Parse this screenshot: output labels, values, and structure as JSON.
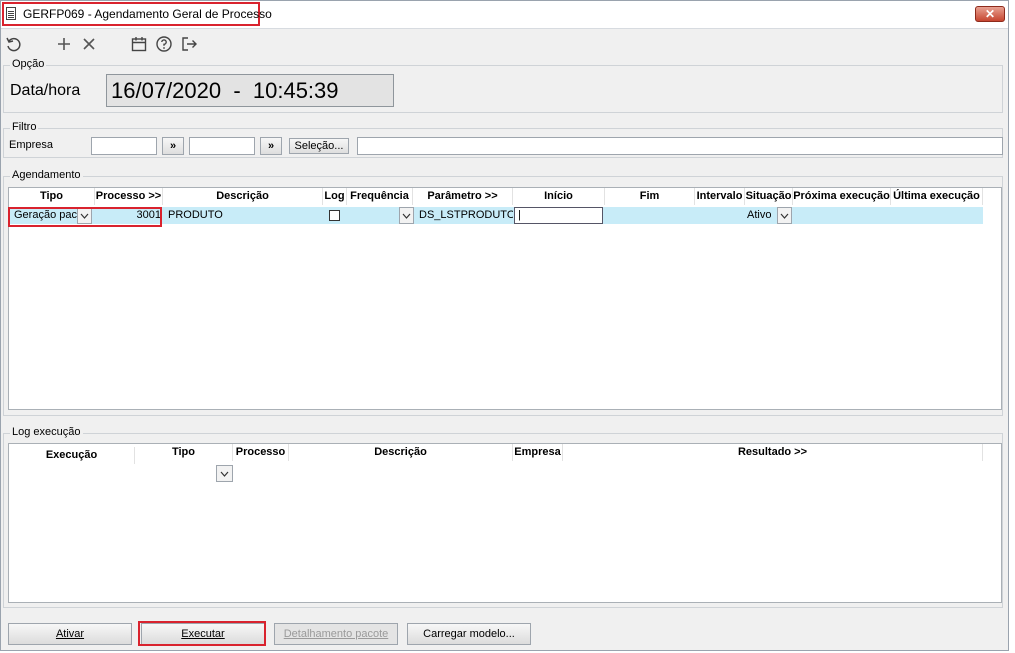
{
  "window": {
    "title": "GERFP069 - Agendamento Geral de Processo",
    "close_glyph": "✕"
  },
  "toolbar": {
    "icons": [
      "undo-icon",
      "plus-icon",
      "close-icon",
      "calendar-icon",
      "help-icon",
      "exit-icon"
    ]
  },
  "opcao": {
    "legend": "Opção",
    "label": "Data/hora",
    "value": "16/07/2020  -  10:45:39"
  },
  "filtro": {
    "legend": "Filtro",
    "empresa_label": "Empresa",
    "from_value": "",
    "to_value": "",
    "arrow1": "»",
    "arrow2": "»",
    "selecao_label": "Seleção...",
    "wide_value": ""
  },
  "agendamento": {
    "legend": "Agendamento",
    "columns": [
      "Tipo",
      "Processo >>",
      "Descrição",
      "Log",
      "Frequência",
      "Parâmetro >>",
      "Início",
      "Fim",
      "Intervalo",
      "Situação",
      "Próxima execução",
      "Última execução"
    ],
    "row": {
      "tipo": "Geração pac",
      "processo": "3001",
      "descricao": "PRODUTO",
      "log_checked": false,
      "frequencia": "",
      "parametro": "DS_LSTPRODUTO=",
      "inicio": "|",
      "fim": "",
      "intervalo": "",
      "situacao": "Ativo",
      "proxima": "",
      "ultima": ""
    }
  },
  "log": {
    "legend": "Log execução",
    "columns": [
      "Execução",
      "Tipo",
      "Processo",
      "Descrição",
      "Empresa",
      "Resultado >>"
    ]
  },
  "buttons": {
    "ativar": "Ativar",
    "executar": "Executar",
    "detalhamento": "Detalhamento pacote",
    "carregar": "Carregar modelo..."
  },
  "colors": {
    "highlight": "#d9232e",
    "row_selected": "#c8ecf8"
  }
}
